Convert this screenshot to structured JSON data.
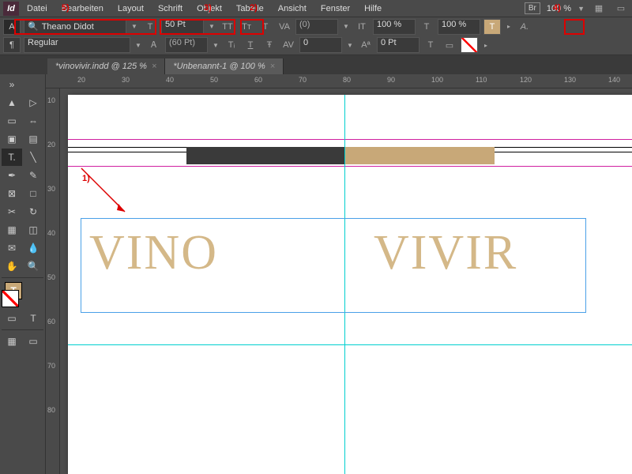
{
  "app": {
    "logo": "Id"
  },
  "menu": [
    "Datei",
    "Bearbeiten",
    "Layout",
    "Schrift",
    "Objekt",
    "Tabelle",
    "Ansicht",
    "Fenster",
    "Hilfe"
  ],
  "top_right": {
    "bridge": "Br",
    "zoom": "100 %"
  },
  "control": {
    "font_name": "Theano Didot",
    "font_style": "Regular",
    "font_size": "50 Pt",
    "leading": "(60 Pt)",
    "kerning": "(0)",
    "tracking": "0",
    "vscale": "100 %",
    "hscale": "100 %",
    "baseline": "0 Pt"
  },
  "tabs": [
    {
      "label": "*vinovivir.indd @ 125 %",
      "active": false
    },
    {
      "label": "*Unbenannt-1 @ 100 %",
      "active": true
    }
  ],
  "ruler_h": [
    "20",
    "30",
    "40",
    "50",
    "60",
    "70",
    "80",
    "90",
    "100",
    "110",
    "120",
    "130",
    "140"
  ],
  "ruler_v": [
    "10",
    "20",
    "30",
    "40",
    "50",
    "60",
    "70",
    "80"
  ],
  "annotations": {
    "a1": "1)",
    "a2": "2)",
    "a3": "3)",
    "a4": "4)",
    "a5": "5)"
  },
  "document": {
    "text_left": "VINO",
    "text_right": "VIVIR"
  },
  "colors": {
    "tan": "#d4b888",
    "frame_blue": "#4aa0e8",
    "guide_cyan": "#00d0d0",
    "guide_magenta": "#d020a0",
    "annotation_red": "#d00"
  }
}
